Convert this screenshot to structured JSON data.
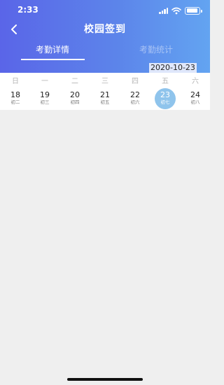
{
  "status_bar": {
    "time": "2:33"
  },
  "header": {
    "title": "校园签到"
  },
  "tabs": [
    {
      "label": "考勤详情",
      "active": true
    },
    {
      "label": "考勤统计",
      "active": false
    }
  ],
  "selected_date": "2020-10-23",
  "calendar": {
    "weekdays": [
      "日",
      "一",
      "二",
      "三",
      "四",
      "五",
      "六"
    ],
    "days": [
      {
        "day": "18",
        "lunar": "初二"
      },
      {
        "day": "19",
        "lunar": "初三"
      },
      {
        "day": "20",
        "lunar": "初四"
      },
      {
        "day": "21",
        "lunar": "初五"
      },
      {
        "day": "22",
        "lunar": "初六"
      },
      {
        "day": "23",
        "lunar": "初七",
        "selected": true
      },
      {
        "day": "24",
        "lunar": "初八"
      }
    ]
  },
  "colors": {
    "header_gradient_start": "#5a65e8",
    "header_gradient_end": "#63a4f1",
    "selected_day": "#8fc4ec",
    "background": "#efefef"
  },
  "icons": {
    "back": "chevron-left-icon",
    "signal": "signal-icon",
    "wifi": "wifi-icon",
    "battery": "battery-icon"
  }
}
